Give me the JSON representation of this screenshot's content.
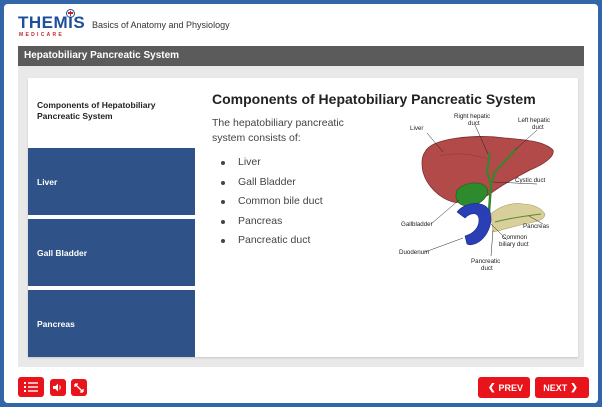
{
  "header": {
    "logo_text": "THEMIS",
    "logo_subtext": "MEDICARE",
    "course_title": "Basics of Anatomy and Physiology"
  },
  "section": {
    "title": "Hepatobiliary Pancreatic System"
  },
  "sidebar": {
    "items": [
      {
        "label": "Components of Hepatobiliary Pancreatic System"
      },
      {
        "label": "Liver"
      },
      {
        "label": "Gall Bladder"
      },
      {
        "label": "Pancreas"
      }
    ]
  },
  "main": {
    "heading": "Components of Hepatobiliary Pancreatic System",
    "intro": "The hepatobiliary pancreatic system consists of:",
    "bullets": [
      "Liver",
      "Gall Bladder",
      "Common bile duct",
      "Pancreas",
      "Pancreatic duct"
    ]
  },
  "diagram": {
    "labels": {
      "liver": "Liver",
      "right_hepatic_1": "Right hepatic",
      "right_hepatic_2": "duct",
      "left_hepatic_1": "Left hepatic",
      "left_hepatic_2": "duct",
      "cystic_duct": "Cystic duct",
      "gallbladder": "Gallbladder",
      "pancreas": "Pancreas",
      "common_1": "Common",
      "common_2": "biliary duct",
      "duodenum": "Duodenum",
      "pancreatic_1": "Pancreatic",
      "pancreatic_2": "duct"
    },
    "colors": {
      "liver": "#b24a4a",
      "gallbladder": "#2d8a2d",
      "duodenum": "#2a3fb5",
      "pancreas": "#d9cf9a"
    }
  },
  "footer": {
    "menu_icon": "list-icon",
    "audio_icon": "speaker-icon",
    "expand_icon": "fullscreen-icon",
    "prev_label": "PREV",
    "next_label": "NEXT"
  },
  "colors": {
    "brand_blue": "#3266a8",
    "sidebar_blue": "#2f5288",
    "accent_red": "#e8131b",
    "section_gray": "#5b5b5b"
  }
}
